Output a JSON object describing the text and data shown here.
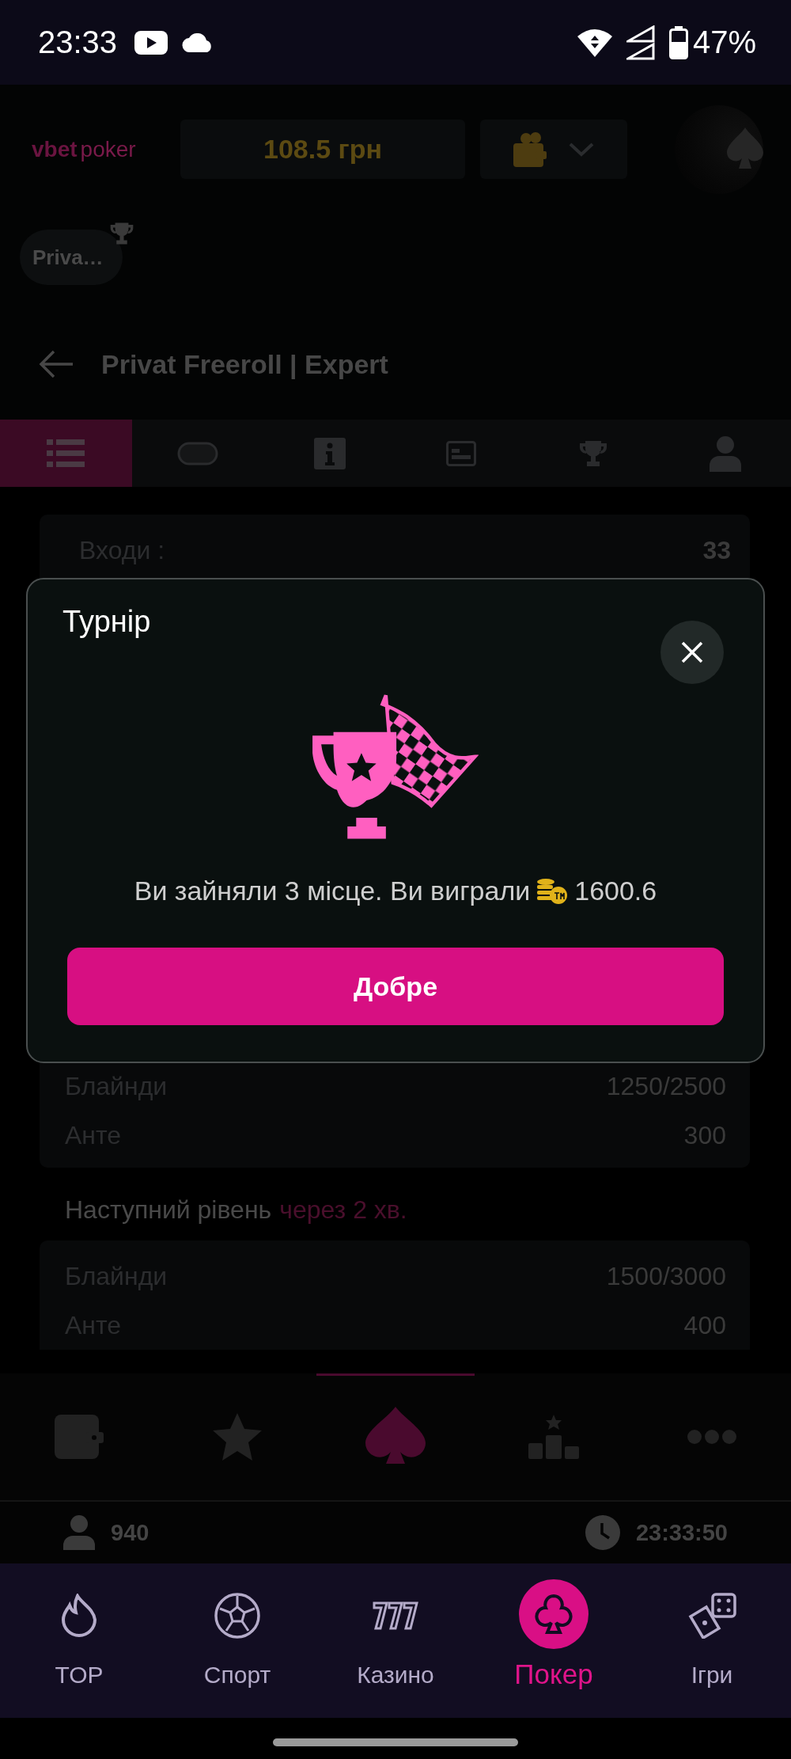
{
  "status_bar": {
    "time": "23:33",
    "battery": "47%"
  },
  "header": {
    "logo_brand": "vbet",
    "logo_product": "poker",
    "balance": "108.5 грн"
  },
  "tournament_chip": {
    "label": "Priva…"
  },
  "page_title": "Privat Freeroll | Expert",
  "tabs": [
    {
      "kind": "list",
      "selected": true
    },
    {
      "kind": "table",
      "selected": false
    },
    {
      "kind": "info",
      "selected": false
    },
    {
      "kind": "card",
      "selected": false
    },
    {
      "kind": "trophy",
      "selected": false
    },
    {
      "kind": "person",
      "selected": false
    }
  ],
  "entries": {
    "label": "Входи :",
    "value": "33"
  },
  "current_level": [
    {
      "label": "Блайнди",
      "value": "1250/2500"
    },
    {
      "label": "Анте",
      "value": "300"
    }
  ],
  "next_level": {
    "label": "Наступний рівень",
    "timing": "через 2 хв.",
    "rows": [
      {
        "label": "Блайнди",
        "value": "1500/3000"
      },
      {
        "label": "Анте",
        "value": "400"
      }
    ]
  },
  "inner_nav": [
    {
      "kind": "wallet",
      "selected": false
    },
    {
      "kind": "star",
      "selected": false
    },
    {
      "kind": "spade",
      "selected": true
    },
    {
      "kind": "podium",
      "selected": false
    },
    {
      "kind": "dots",
      "selected": false
    }
  ],
  "footer_info": {
    "players": "940",
    "clock": "23:33:50"
  },
  "bottom_nav": [
    {
      "kind": "flame",
      "label": "TOP",
      "selected": false
    },
    {
      "kind": "ball",
      "label": "Спорт",
      "selected": false
    },
    {
      "kind": "sevens",
      "label": "Казино",
      "selected": false
    },
    {
      "kind": "club",
      "label": "Покер",
      "selected": true
    },
    {
      "kind": "dice",
      "label": "Ігри",
      "selected": false
    }
  ],
  "dialog": {
    "title": "Турнір",
    "message": "Ви зайняли 3 місце. Ви виграли",
    "amount": "1600.6",
    "button": "Добре"
  }
}
